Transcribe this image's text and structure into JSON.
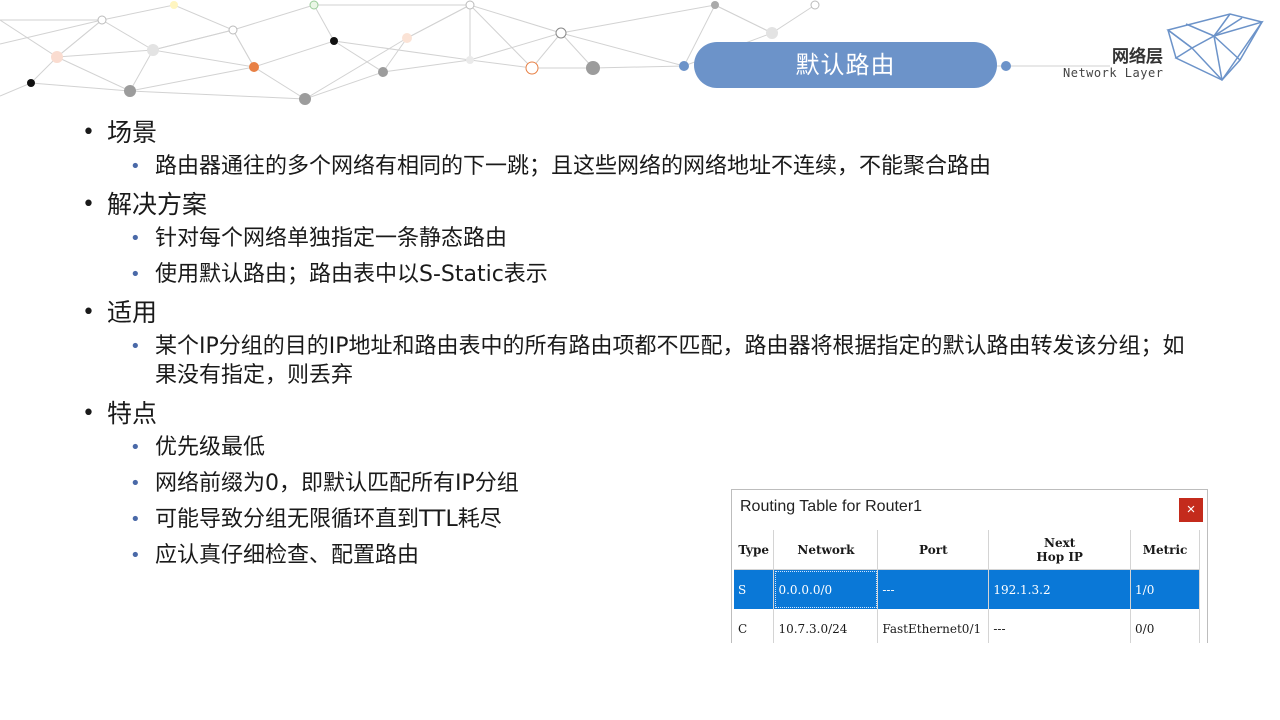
{
  "header": {
    "title": "默认路由",
    "brand_cn": "网络层",
    "brand_en": "Network Layer"
  },
  "bullets": [
    {
      "heading": "场景",
      "items": [
        "路由器通往的多个网络有相同的下一跳；且这些网络的网络地址不连续，不能聚合路由"
      ]
    },
    {
      "heading": "解决方案",
      "items": [
        "针对每个网络单独指定一条静态路由",
        "使用默认路由；路由表中以S-Static表示"
      ]
    },
    {
      "heading": "适用",
      "items": [
        "某个IP分组的目的IP地址和路由表中的所有路由项都不匹配，路由器将根据指定的默认路由转发该分组；如果没有指定，则丢弃"
      ]
    },
    {
      "heading": "特点",
      "items": [
        "优先级最低",
        "网络前缀为0，即默认匹配所有IP分组",
        "可能导致分组无限循环直到TTL耗尽",
        "应认真仔细检查、配置路由"
      ]
    }
  ],
  "routing_window": {
    "title": "Routing Table for Router1",
    "close_glyph": "×",
    "columns": [
      "Type",
      "Network",
      "Port",
      "Next\nHop IP",
      "Metric"
    ],
    "rows": [
      {
        "type": "S",
        "network": "0.0.0.0/0",
        "port": "---",
        "next_hop": "192.1.3.2",
        "metric": "1/0",
        "selected": true
      },
      {
        "type": "C",
        "network": "10.7.3.0/24",
        "port": "FastEthernet0/1",
        "next_hop": "---",
        "metric": "0/0",
        "selected": false
      }
    ]
  },
  "colors": {
    "accent": "#6c93c9",
    "selection": "#0a78d7",
    "close": "#c42b1c",
    "bullet": "#4a69a8"
  }
}
